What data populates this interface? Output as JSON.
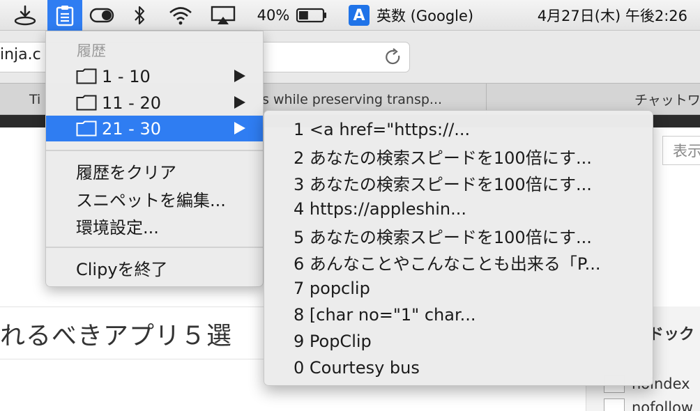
{
  "menubar": {
    "battery_percent": "40%",
    "input_method_icon_letter": "A",
    "input_method_label": "英数 (Google)",
    "datetime": "4月27日(木) 午後2:26",
    "battery_level": 0.4,
    "icons": [
      "download-icon",
      "clipboard-icon",
      "toggle-icon",
      "bluetooth-icon",
      "wifi-icon",
      "airplay-icon",
      "battery-icon"
    ]
  },
  "browser": {
    "url_fragment": "inja.c",
    "tabs": [
      "Ti",
      "s while preserving transp...",
      "チャットワ"
    ],
    "right_box_text": "表示",
    "article_title": "れるべきアプリ５選",
    "sidebar_heading": "ドック",
    "checkboxes": [
      "noindex",
      "nofollow"
    ]
  },
  "clipy_menu": {
    "header": "履歴",
    "folders": [
      {
        "label": "1 - 10"
      },
      {
        "label": "11 - 20"
      },
      {
        "label": "21 - 30"
      }
    ],
    "selected_folder": "21 - 30",
    "actions": [
      "履歴をクリア",
      "スニペットを編集...",
      "環境設定..."
    ],
    "quit": "Clipyを終了"
  },
  "submenu": {
    "items": [
      "1 <a href=\"https://...",
      "2 あなたの検索スピードを100倍にす...",
      "3 あなたの検索スピードを100倍にす...",
      "4 https://appleshin...",
      "5 あなたの検索スピードを100倍にす...",
      "6 あんなことやこんなことも出来る「P...",
      "7 popclip",
      "8 [char no=\"1\" char...",
      "9 PopClip",
      "0 Courtesy bus"
    ]
  }
}
